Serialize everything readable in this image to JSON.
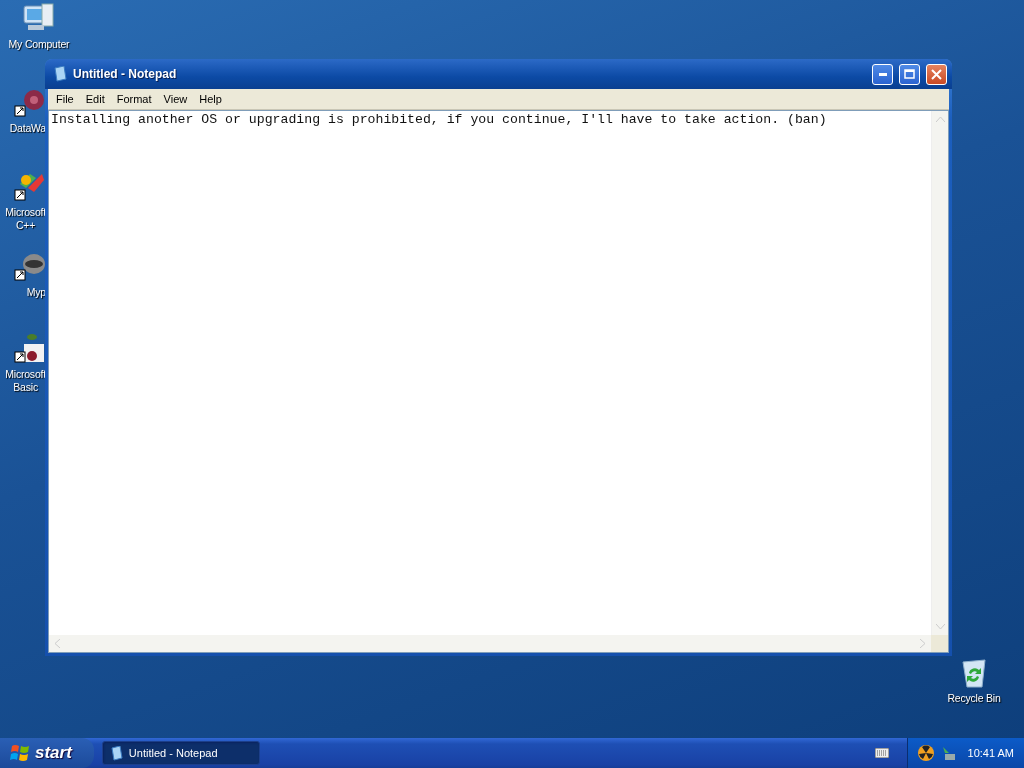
{
  "desktop_icons": [
    {
      "label": "My Computer",
      "kind": "computer"
    },
    {
      "label": "DataWa",
      "kind": "data"
    },
    {
      "label": "Microsoft\nC++",
      "kind": "cpp"
    },
    {
      "label": "Myp",
      "kind": "animal"
    },
    {
      "label": "Microsoft\nBasic",
      "kind": "basic"
    },
    {
      "label": "Recycle Bin",
      "kind": "bin"
    }
  ],
  "window": {
    "title": "Untitled - Notepad",
    "menu": [
      "File",
      "Edit",
      "Format",
      "View",
      "Help"
    ],
    "text": "Installing another OS or upgrading is prohibited, if you continue, I'll have to take action. (ban)"
  },
  "taskbar": {
    "start": "start",
    "tasks": [
      {
        "label": "Untitled - Notepad",
        "selected": true
      }
    ],
    "clock": "10:41 AM"
  }
}
